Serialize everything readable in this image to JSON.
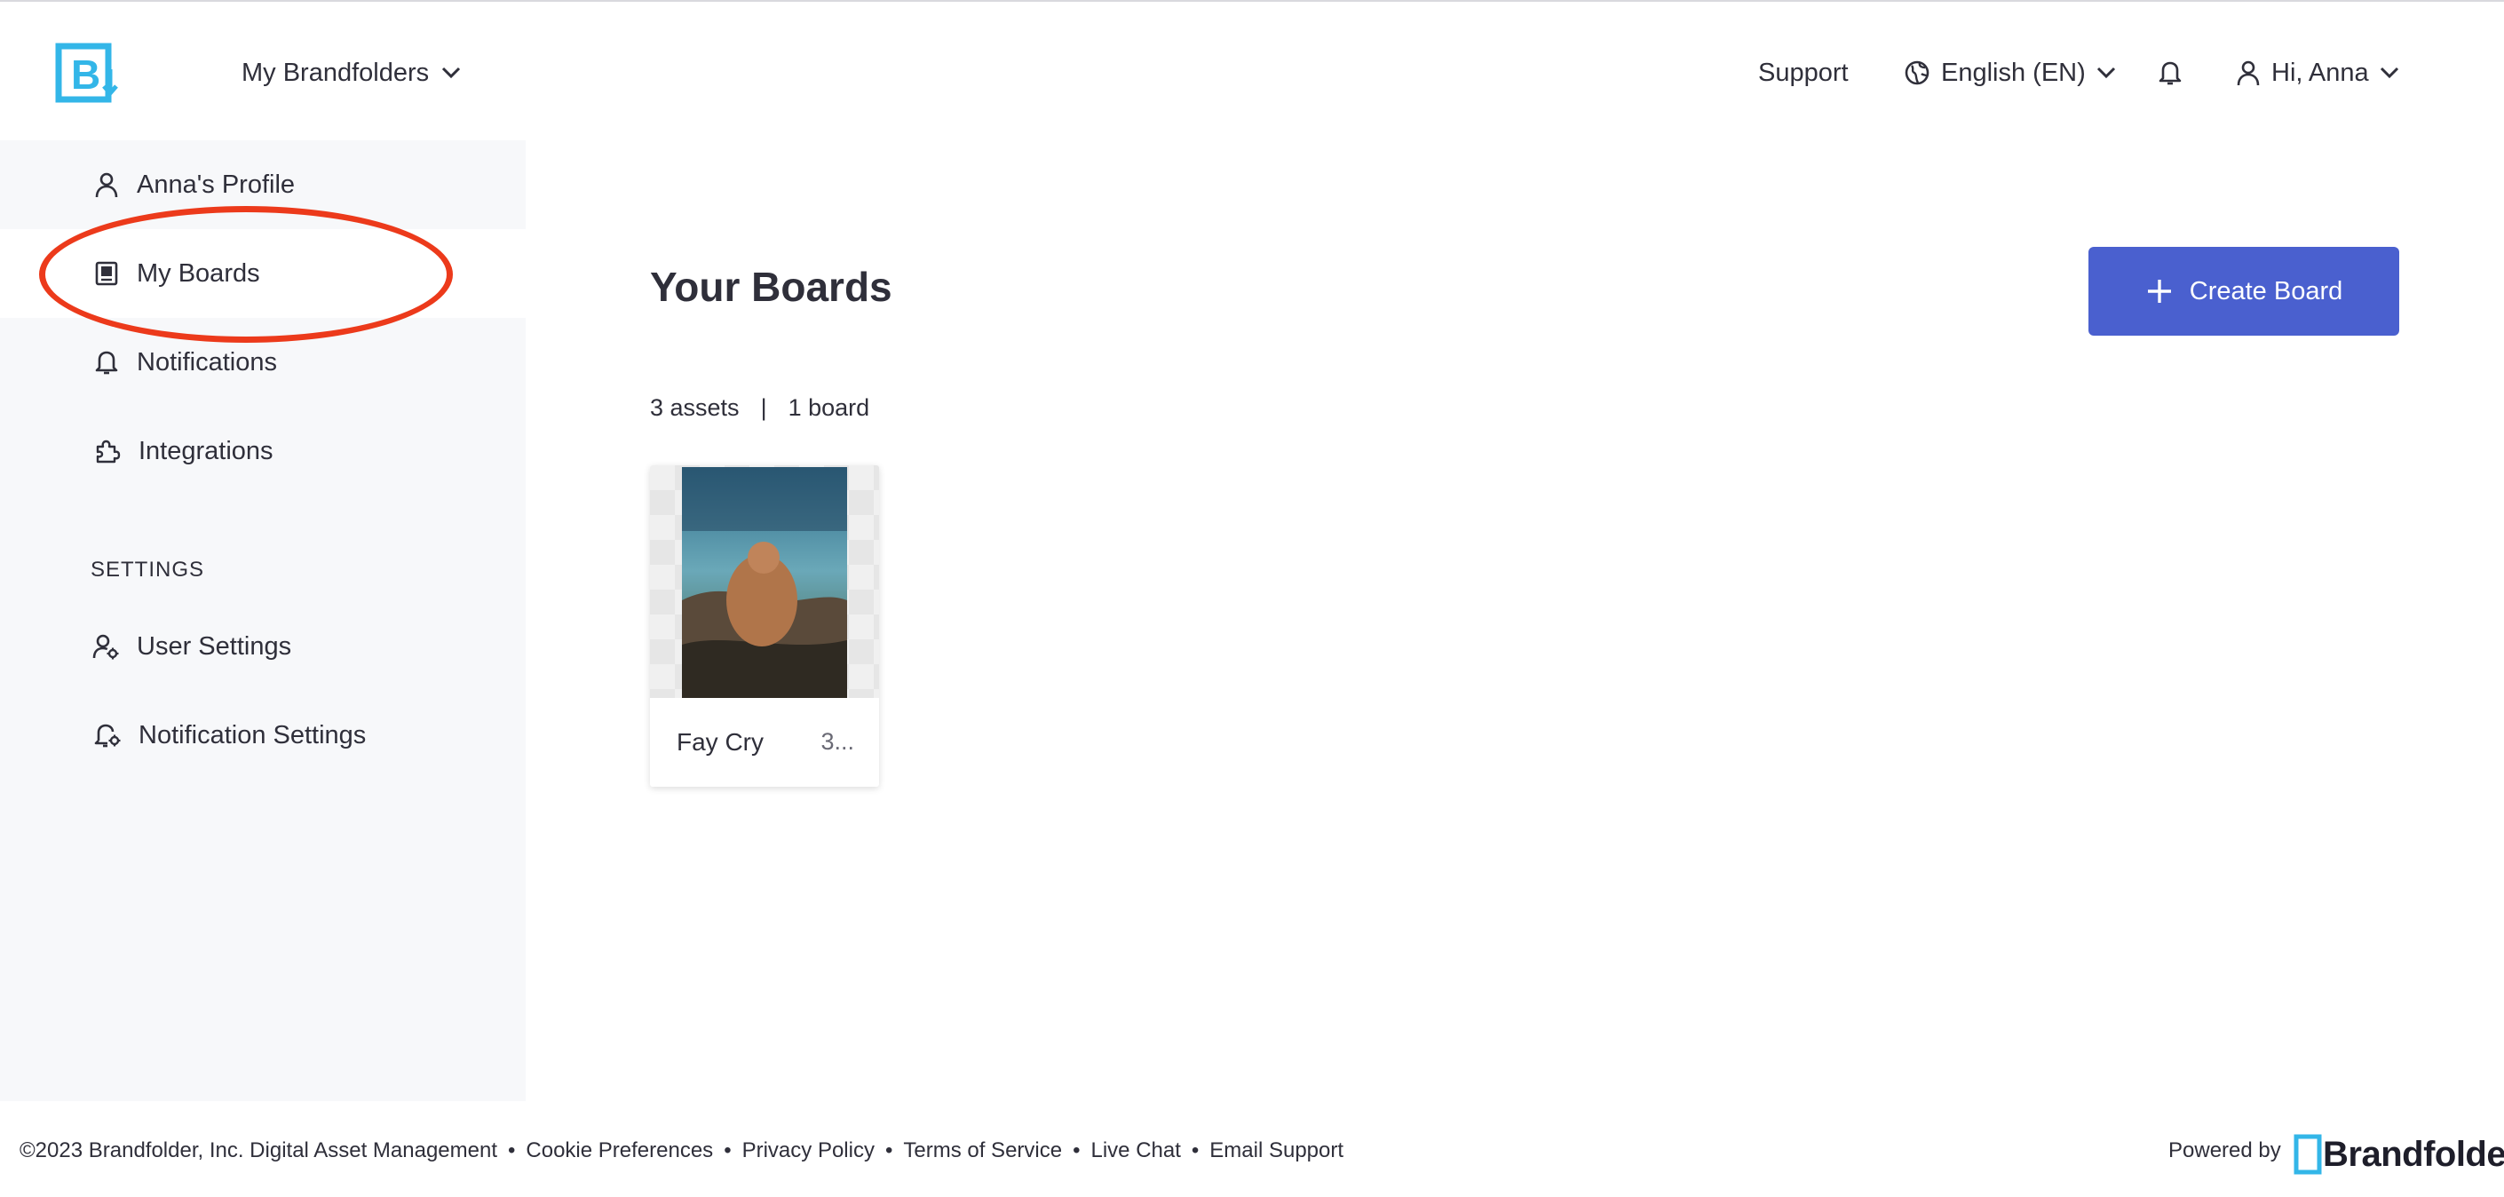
{
  "header": {
    "brandfolder_switcher": "My Brandfolders",
    "support": "Support",
    "language": "English (EN)",
    "greeting": "Hi, Anna"
  },
  "sidebar": {
    "items": [
      {
        "label": "Anna's Profile",
        "icon": "person-icon"
      },
      {
        "label": "My Boards",
        "icon": "board-icon",
        "active": true
      },
      {
        "label": "Notifications",
        "icon": "bell-icon"
      },
      {
        "label": "Integrations",
        "icon": "puzzle-icon"
      }
    ],
    "settings_heading": "SETTINGS",
    "settings_items": [
      {
        "label": "User Settings",
        "icon": "user-gear-icon"
      },
      {
        "label": "Notification Settings",
        "icon": "bell-gear-icon"
      }
    ]
  },
  "main": {
    "title": "Your Boards",
    "create_button": "Create Board",
    "assets_count": "3 assets",
    "separator": "|",
    "boards_count": "1 board",
    "boards": [
      {
        "name": "Fay Cry",
        "count": "3..."
      }
    ]
  },
  "footer": {
    "copyright": "©2023 Brandfolder, Inc. Digital Asset Management",
    "links": [
      "Cookie Preferences",
      "Privacy Policy",
      "Terms of Service",
      "Live Chat",
      "Email Support"
    ],
    "powered_by": "Powered by",
    "brand_word": "Brandfolder"
  },
  "colors": {
    "accent": "#4a60cf",
    "logo": "#33b6e8",
    "highlight_oval": "#ec3a1b"
  }
}
